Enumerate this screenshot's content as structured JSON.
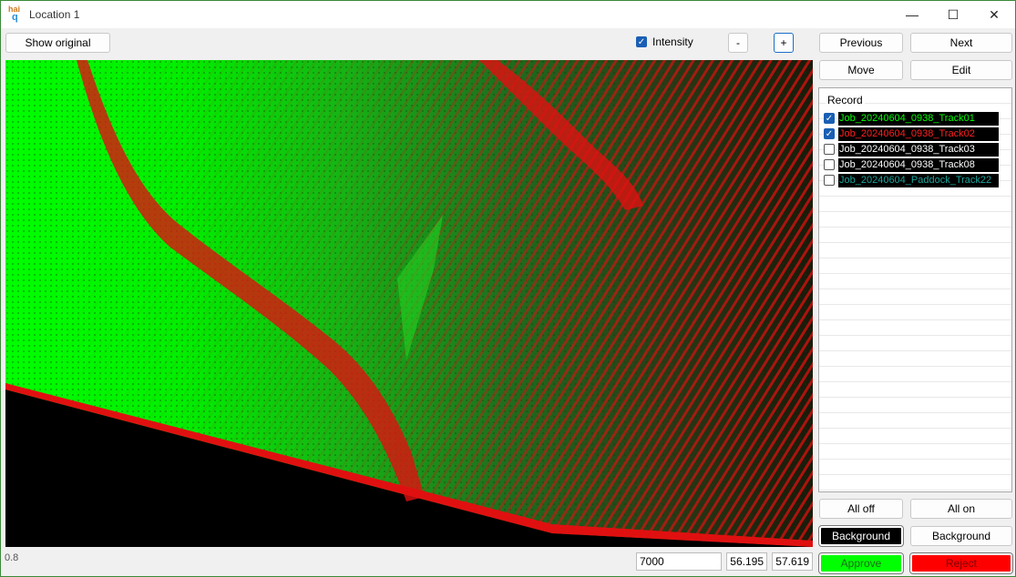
{
  "window": {
    "title": "Location 1",
    "icon_text_top": "hai",
    "icon_text_bottom": "q"
  },
  "toolbar": {
    "show_original": "Show original",
    "intensity_label": "Intensity",
    "intensity_checked": true,
    "zoom_out": "-",
    "zoom_in": "+"
  },
  "nav": {
    "previous": "Previous",
    "next": "Next",
    "move": "Move",
    "edit": "Edit"
  },
  "records": {
    "header": "Record",
    "items": [
      {
        "label": "Job_20240604_0938_Track01",
        "checked": true,
        "color": "#00ff00"
      },
      {
        "label": "Job_20240604_0938_Track02",
        "checked": true,
        "color": "#ff2020"
      },
      {
        "label": "Job_20240604_0938_Track03",
        "checked": false,
        "color": "#ffffff"
      },
      {
        "label": "Job_20240604_0938_Track08",
        "checked": false,
        "color": "#ffffff"
      },
      {
        "label": "Job_20240604_Paddock_Track22",
        "checked": false,
        "color": "#1aa39a"
      }
    ]
  },
  "controls": {
    "all_off": "All off",
    "all_on": "All on",
    "background_dark": "Background",
    "background_light": "Background",
    "approve": "Approve",
    "reject": "Reject"
  },
  "status": {
    "scale": "0.8",
    "value": "7000",
    "coord_a": "56.195",
    "coord_b": "57.619"
  },
  "colors": {
    "accent": "#1a5fb4",
    "approve": "#00ff00",
    "reject": "#ff0000",
    "point_green": "#00ff00",
    "point_red": "#ff0000"
  }
}
